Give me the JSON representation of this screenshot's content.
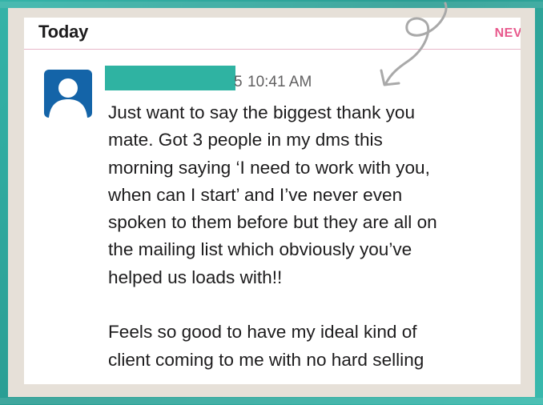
{
  "header": {
    "today_label": "Today",
    "new_label": "NEV"
  },
  "message": {
    "sender_name_redacted": true,
    "time_prefix": "5",
    "timestamp": "10:41 AM",
    "lines": [
      "Just want to say the biggest thank you",
      "mate. Got 3 people in my dms this",
      "morning saying ‘I need to work with you,",
      "when can I start’ and I’ve never even",
      "spoken to them before but they are all on",
      "the mailing list which obviously you’ve",
      "helped us loads with!!",
      "",
      "Feels so good to have my ideal kind of",
      "client coming to me with no hard selling"
    ]
  },
  "colors": {
    "background_teal": "#2fa89e",
    "frame_beige": "#e6e0d8",
    "avatar_blue": "#1464a8",
    "redaction_teal": "#2fb3a2",
    "new_pink": "#e8588c",
    "text_dark": "#1d1c1d",
    "text_gray": "#616061"
  },
  "icons": {
    "avatar": "default-user-avatar-icon",
    "arrow": "curved-arrow-icon"
  }
}
